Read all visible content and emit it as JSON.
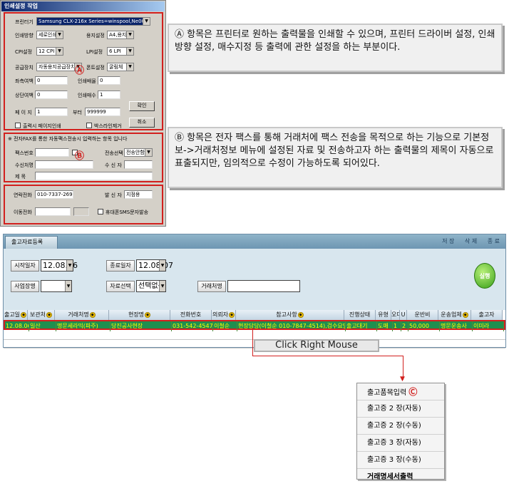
{
  "print_dialog": {
    "title": "인쇄설정 작업",
    "printer_label": "프린터기",
    "printer_value": "Samsung CLX-216x Series=winspool,Ne00",
    "orientation_label": "인쇄방향",
    "orientation_value": "세로인쇄",
    "paper_label": "용지설정",
    "paper_value": "A4,용지",
    "cpi_label": "CPI설정",
    "cpi_value": "12 CPI",
    "lpi_label": "LPI설정",
    "lpi_value": "6 LPI",
    "feed_label": "공급장치",
    "feed_value": "자동용지공급장치",
    "font_label": "폰트설정",
    "font_value": "굴림체",
    "left_margin_label": "좌측여백",
    "left_margin_value": "0",
    "scale_label": "인쇄배율",
    "scale_value": "0",
    "top_margin_label": "상단여백",
    "top_margin_value": "0",
    "copies_label": "인쇄매수",
    "copies_value": "1",
    "page_label": "페 이 지",
    "page_from": "1",
    "page_to_label": "부터",
    "page_to": "999999",
    "confirm_button": "확인",
    "cancel_button": "취소",
    "output_page_check": "출력시 페이지인쇄",
    "box_line_check": "박스라인제거",
    "marker_a": "Ⓐ",
    "fax_header": "※ 전자FAX를 통한 자동팩스전송시 입력하는 항목 입니다",
    "fax_number_label": "팩스번호",
    "send_select_label": "전송선택",
    "send_select_value": "전송안함",
    "receiver_company_label": "수신처명",
    "receiver_label": "수 신 자",
    "subject_label": "제   목",
    "marker_b": "Ⓑ",
    "contact_label": "연락전화",
    "contact_value": "010-7337-2692",
    "sender_label": "발 신 자",
    "sender_value": "지점용",
    "mobile_label": "이동전화",
    "sms_check": "휴대폰SMS문자발송"
  },
  "callouts": {
    "a_text": "Ⓐ 항목은 프린터로 원하는 출력물을 인쇄할 수 있으며, 프린터 드라이버 설정, 인쇄방향 설정, 매수지정 등 출력에 관한 설정을 하는 부분이다.",
    "b_text": "Ⓑ 항목은 전자 팩스를 통해 거래처에 팩스 전송을 목적으로 하는 기능으로 기본정보->거래처정보 메뉴에 설정된 자료 및 전송하고자 하는 출력물의 제목이 자동으로 표출되지만, 임의적으로 수정이 가능하도록 되어있다."
  },
  "app": {
    "tab_label": "출고자료등록",
    "toolbar": [
      "저 장",
      "삭 제",
      "종 료"
    ],
    "start_date_label": "시작일자",
    "start_date": "12.08.06",
    "end_date_label": "종료일자",
    "end_date": "12.08.07",
    "site_label": "사업장명",
    "site_value": "",
    "data_select_label": "자료선택",
    "data_select_value": "선택없음",
    "client_label": "거래처명",
    "client_value": "",
    "run_button": "실행",
    "columns": [
      "출고일",
      "보관처",
      "거래처명",
      "현장명",
      "전화번호",
      "의뢰자",
      "참고사항",
      "진행상태",
      "유형",
      "오더",
      "U",
      "운반비",
      "운송업체",
      "출고자"
    ],
    "rows": [
      [
        "12.08.06",
        "일산",
        "명문세라믹(파주)",
        "당진공사현장",
        "031-542-4547",
        "이철순",
        "현장담당(이철순 010-7847-4514),검수요망",
        "출고대기",
        "도매",
        "1",
        "2",
        "50,000",
        "명문운송사",
        "이미라"
      ]
    ]
  },
  "right_click_label": "Click Right Mouse",
  "context_menu": {
    "items": [
      "출고품목입력",
      "출고증 2 장(자동)",
      "출고증 2 장(수동)",
      "출고증 3 장(자동)",
      "출고증 3 장(수동)",
      "거래명세서출력"
    ],
    "marker_c": "Ⓒ"
  },
  "colors": {
    "highlight_row": "#1f8f4f",
    "highlight_text": "#ffff00",
    "annotation_red": "#d2201e"
  }
}
